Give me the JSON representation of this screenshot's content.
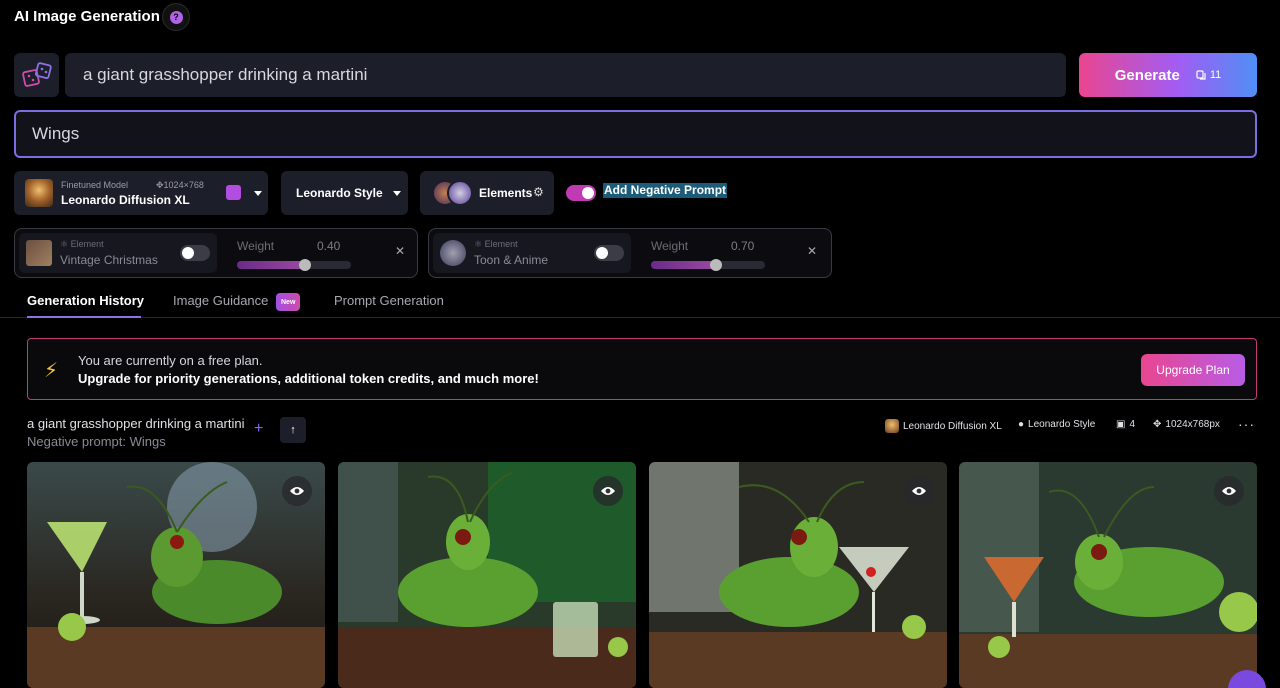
{
  "header": {
    "title": "AI Image Generation",
    "help_icon": "question-icon"
  },
  "prompt": {
    "value": "a giant grasshopper drinking a martini",
    "placeholder": ""
  },
  "generate": {
    "label": "Generate",
    "tokens": "11"
  },
  "negative_prompt": {
    "value": "Wings"
  },
  "model": {
    "caption": "Finetuned Model",
    "resolution": "1024×768",
    "name": "Leonardo Diffusion XL"
  },
  "style": {
    "label": "Leonardo Style"
  },
  "elements": {
    "label": "Elements"
  },
  "negative_toggle": {
    "label": "Add Negative Prompt",
    "on": true
  },
  "element_cards": [
    {
      "caption": "Element",
      "name": "Vintage Christmas",
      "weight_label": "Weight",
      "weight": "0.40",
      "fraction": 0.4,
      "enabled": false
    },
    {
      "caption": "Element",
      "name": "Toon & Anime",
      "weight_label": "Weight",
      "weight": "0.70",
      "fraction": 0.7,
      "enabled": false
    }
  ],
  "tabs": [
    {
      "label": "Generation History",
      "active": true
    },
    {
      "label": "Image Guidance",
      "badge": "New"
    },
    {
      "label": "Prompt Generation"
    }
  ],
  "banner": {
    "line1": "You are currently on a free plan.",
    "line2": "Upgrade for priority generations, additional token credits, and much more!",
    "button": "Upgrade Plan"
  },
  "generation": {
    "prompt": "a giant grasshopper drinking a martini",
    "negative": "Negative prompt: Wings",
    "model": "Leonardo Diffusion XL",
    "style": "Leonardo Style",
    "count": "4",
    "size": "1024x768px"
  },
  "colors": {
    "accent": "#7b6de2",
    "brand_pink": "#e9468f",
    "banner_border": "#c23b76"
  }
}
